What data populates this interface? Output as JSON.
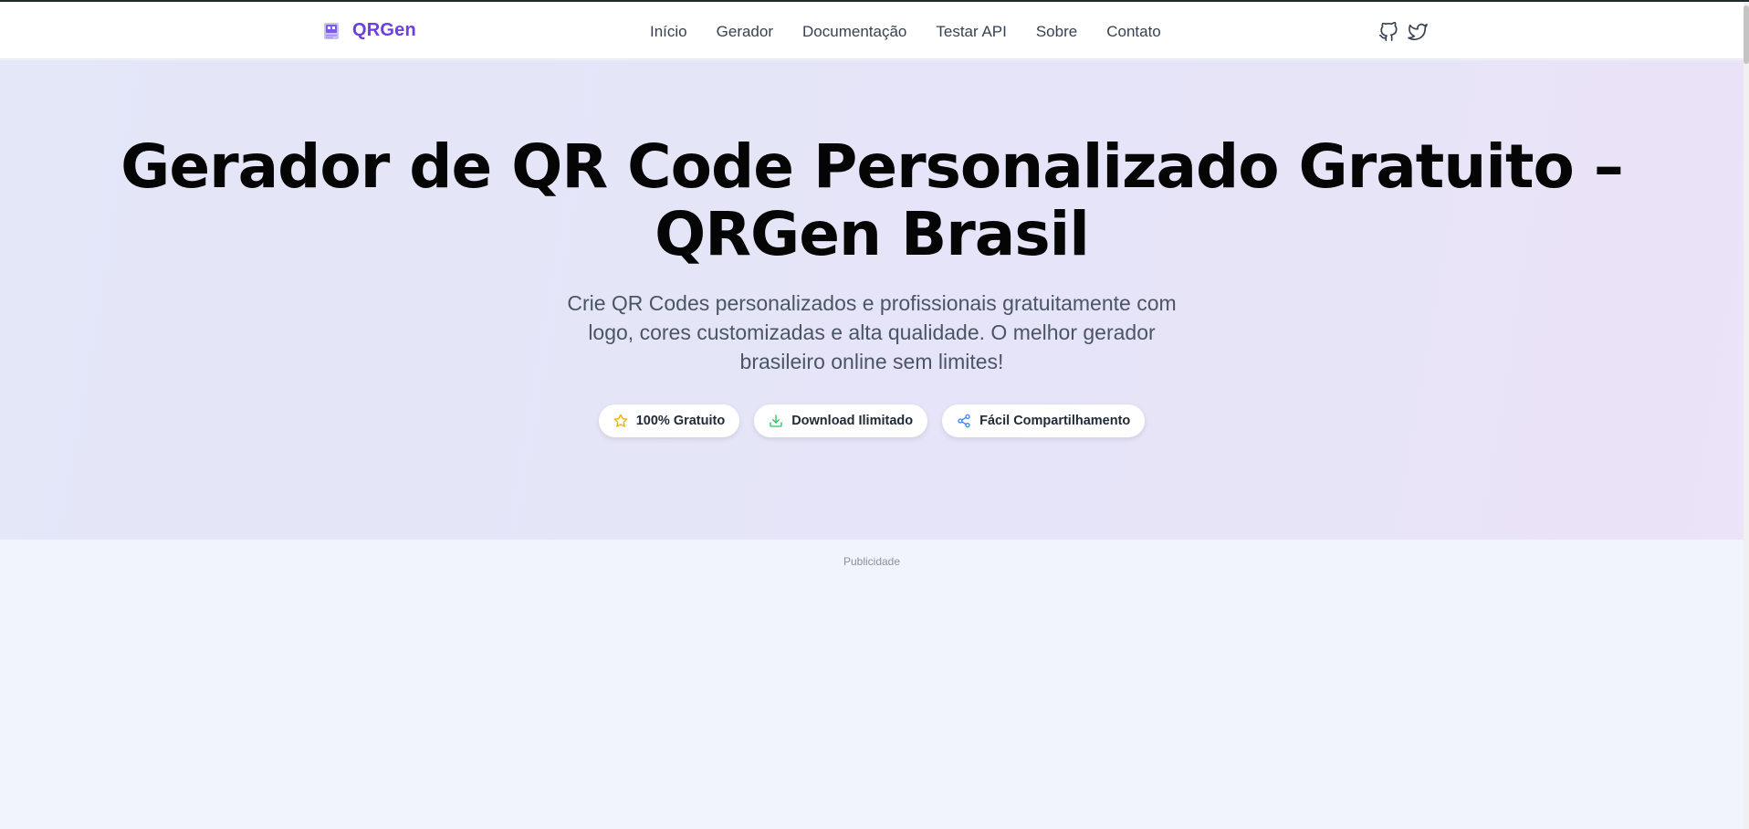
{
  "brand": {
    "name": "QRGen",
    "color": "#6d3fe0"
  },
  "nav": {
    "links": [
      {
        "label": "Início"
      },
      {
        "label": "Gerador"
      },
      {
        "label": "Documentação"
      },
      {
        "label": "Testar API"
      },
      {
        "label": "Sobre"
      },
      {
        "label": "Contato"
      }
    ],
    "social_icons": [
      "github-icon",
      "twitter-icon"
    ]
  },
  "hero": {
    "title": "Gerador de QR Code Personalizado Gratuito – QRGen Brasil",
    "subtitle": "Crie QR Codes personalizados e profissionais gratuitamente com logo, cores customizadas e alta qualidade. O melhor gerador brasileiro online sem limites!",
    "features": [
      {
        "label": "100% Gratuito",
        "icon": "star-icon",
        "color": "#eab308"
      },
      {
        "label": "Download Ilimitado",
        "icon": "download-icon",
        "color": "#22c55e"
      },
      {
        "label": "Fácil Compartilhamento",
        "icon": "share-icon",
        "color": "#3b82f6"
      }
    ]
  },
  "ad": {
    "label": "Publicidade"
  }
}
